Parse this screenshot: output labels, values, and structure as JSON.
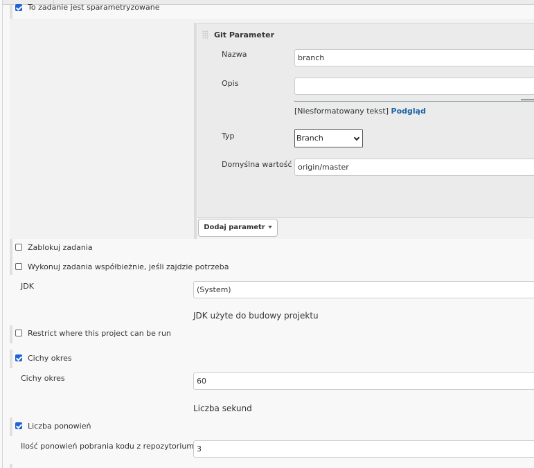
{
  "parameterized": {
    "label": "To zadanie jest sparametryzowane",
    "checked": true
  },
  "git_parameter": {
    "title": "Git Parameter",
    "fields": {
      "name": {
        "label": "Nazwa",
        "value": "branch"
      },
      "description": {
        "label": "Opis",
        "value": ""
      },
      "format_hint": "[Niesformatowany tekst]",
      "preview_link": "Podgląd",
      "type": {
        "label": "Typ",
        "selected": "Branch"
      },
      "default_value": {
        "label": "Domyślna wartość",
        "value": "origin/master"
      }
    }
  },
  "add_parameter_button": "Dodaj parametr",
  "options": {
    "block_jobs": {
      "label": "Zablokuj zadania",
      "checked": false
    },
    "concurrent": {
      "label": "Wykonuj zadania współbieżnie, jeśli zajdzie potrzeba",
      "checked": false
    },
    "jdk": {
      "label": "JDK",
      "value": "(System)",
      "description": "JDK użyte do budowy projektu"
    },
    "restrict": {
      "label": "Restrict where this project can be run",
      "checked": false
    },
    "quiet_period": {
      "label": "Cichy okres",
      "checked": true,
      "field_label": "Cichy okres",
      "value": "60",
      "description": "Liczba sekund"
    },
    "retry_count": {
      "label": "Liczba ponowień",
      "checked": true,
      "field_label": "Ilość ponowień pobrania kodu z repozytorium",
      "value": "3"
    }
  }
}
